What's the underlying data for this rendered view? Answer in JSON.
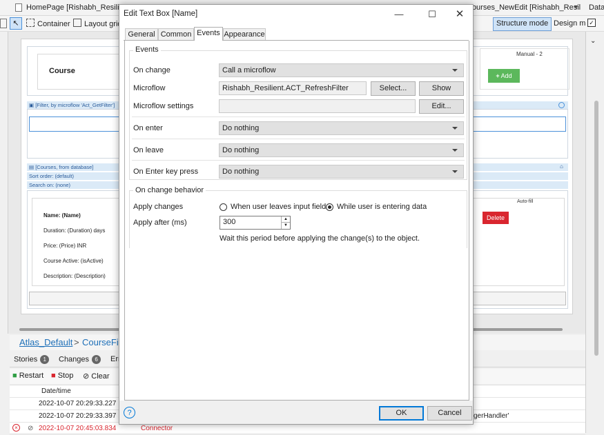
{
  "ide": {
    "doc_tabs": [
      "HomePage [Rishabh_Resilient]",
      "Courses_NewEdit [Rishabh_Resil",
      "Data"
    ],
    "toolbar": {
      "container": "Container",
      "layout_grid": "Layout grid",
      "structure_mode": "Structure mode",
      "design_mode": "Design m"
    },
    "canvas": {
      "course_title": "Course",
      "manual_label": "Manual - 2",
      "add_button": "Add",
      "filter_caption": "[Filter, by microflow 'Act_GetFilter']",
      "list_caption": "[Courses, from database]",
      "sort_order": "Sort order: (default)",
      "search_on": "Search on: (none)",
      "autofill": "Auto-fill",
      "delete_button": "Delete",
      "fields": [
        "Name: (Name)",
        "Duration: (Duration) days",
        "Price: (Price) INR",
        "Course Active: (isActive)",
        "Description: (Description)"
      ]
    },
    "breadcrumb": [
      "Atlas_Default",
      ">",
      "CourseFilt"
    ],
    "panel_tabs": [
      {
        "label": "Stories",
        "count": "1"
      },
      {
        "label": "Changes",
        "count": "6"
      },
      {
        "label": "Err"
      }
    ],
    "panel_toolbar": {
      "restart": "Restart",
      "stop": "Stop",
      "clear": "Clear"
    },
    "log": {
      "header": "Date/time",
      "rows": [
        {
          "time": "2022-10-07 20:29:33.227",
          "source": "",
          "message": ""
        },
        {
          "time": "2022-10-07 20:29:33.397",
          "source": "",
          "message": "gerHandler'"
        },
        {
          "time": "2022-10-07 20:45:03.834",
          "source": "Connector",
          "message": ""
        }
      ]
    }
  },
  "dialog": {
    "title": "Edit Text Box [Name]",
    "tabs": [
      "General",
      "Common",
      "Events",
      "Appearance"
    ],
    "active_tab": "Events",
    "events": {
      "group_label": "Events",
      "on_change_label": "On change",
      "on_change_value": "Call a microflow",
      "microflow_label": "Microflow",
      "microflow_value": "Rishabh_Resilient.ACT_RefreshFilter",
      "select_button": "Select...",
      "show_button": "Show",
      "settings_label": "Microflow settings",
      "settings_value": "",
      "edit_button": "Edit...",
      "on_enter_label": "On enter",
      "on_enter_value": "Do nothing",
      "on_leave_label": "On leave",
      "on_leave_value": "Do nothing",
      "on_enter_key_label": "On Enter key press",
      "on_enter_key_value": "Do nothing"
    },
    "behavior": {
      "group_label": "On change behavior",
      "apply_changes_label": "Apply changes",
      "option_leave": "When user leaves input field",
      "option_entering": "While user is entering data",
      "selected": "While user is entering data",
      "apply_after_label": "Apply after (ms)",
      "apply_after_value": "300",
      "hint": "Wait this period before applying the change(s) to the object."
    },
    "ok_button": "OK",
    "cancel_button": "Cancel",
    "colors": {
      "accent": "#0078d7",
      "add_green": "#5cb85c",
      "delete_red": "#d9262f",
      "link_blue": "#1d6fb8"
    }
  }
}
